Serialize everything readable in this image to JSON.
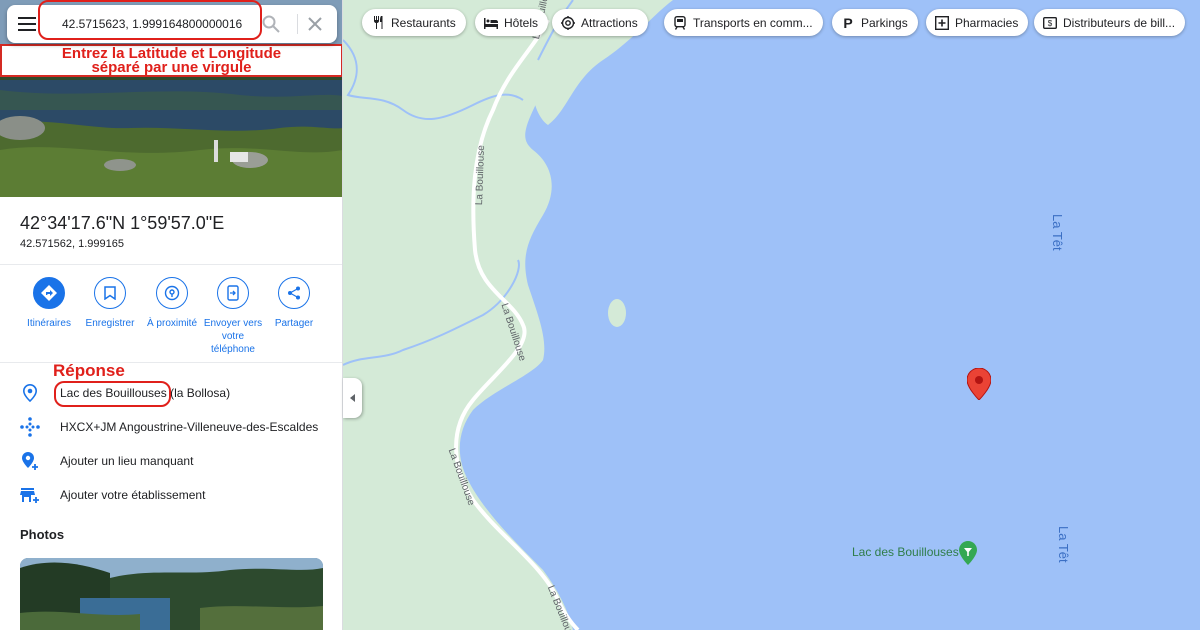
{
  "search": {
    "value": "42.5715623, 1.999164800000016",
    "menu_icon": "hamburger-menu-icon",
    "search_icon": "magnifier-icon",
    "close_icon": "close-x-icon"
  },
  "annotations": {
    "instruction_line1": "Entrez la Latitude et Longitude",
    "instruction_line2": "séparé par une virgule",
    "reponse": "Réponse",
    "color": "#e0201b"
  },
  "place": {
    "coord_dms": "42°34'17.6\"N 1°59'57.0\"E",
    "coord_decimal": "42.571562, 1.999165"
  },
  "actions": [
    {
      "label": "Itinéraires",
      "icon": "directions-icon"
    },
    {
      "label": "Enregistrer",
      "icon": "bookmark-icon"
    },
    {
      "label": "À proximité",
      "icon": "nearby-search-icon"
    },
    {
      "label": "Envoyer vers votre téléphone",
      "icon": "send-to-phone-icon"
    },
    {
      "label": "Partager",
      "icon": "share-icon"
    }
  ],
  "info": {
    "lake_name": "Lac des Bouillouses",
    "lake_suffix": " (la Bollosa)",
    "plus_code": "HXCX+JM Angoustrine-Villeneuve-des-Escaldes",
    "add_place": "Ajouter un lieu manquant",
    "add_business": "Ajouter votre établissement"
  },
  "photos_title": "Photos",
  "chips": [
    {
      "label": "Restaurants",
      "icon": "fork-knife-icon"
    },
    {
      "label": "Hôtels",
      "icon": "bed-icon"
    },
    {
      "label": "Attractions",
      "icon": "camera-icon"
    },
    {
      "label": "Transports en comm...",
      "icon": "train-icon"
    },
    {
      "label": "Parkings",
      "icon": "parking-icon"
    },
    {
      "label": "Pharmacies",
      "icon": "pharmacy-icon"
    },
    {
      "label": "Distributeurs de bill...",
      "icon": "atm-icon"
    }
  ],
  "map": {
    "road_label": "La Bouillouse",
    "river_label": "La Têt",
    "poi_label": "Lac des Bouillouses",
    "water_color": "#9ec1f8",
    "land_color": "#d4ead7",
    "pin_color": "#ea4335",
    "accent_color": "#1a73e8"
  }
}
